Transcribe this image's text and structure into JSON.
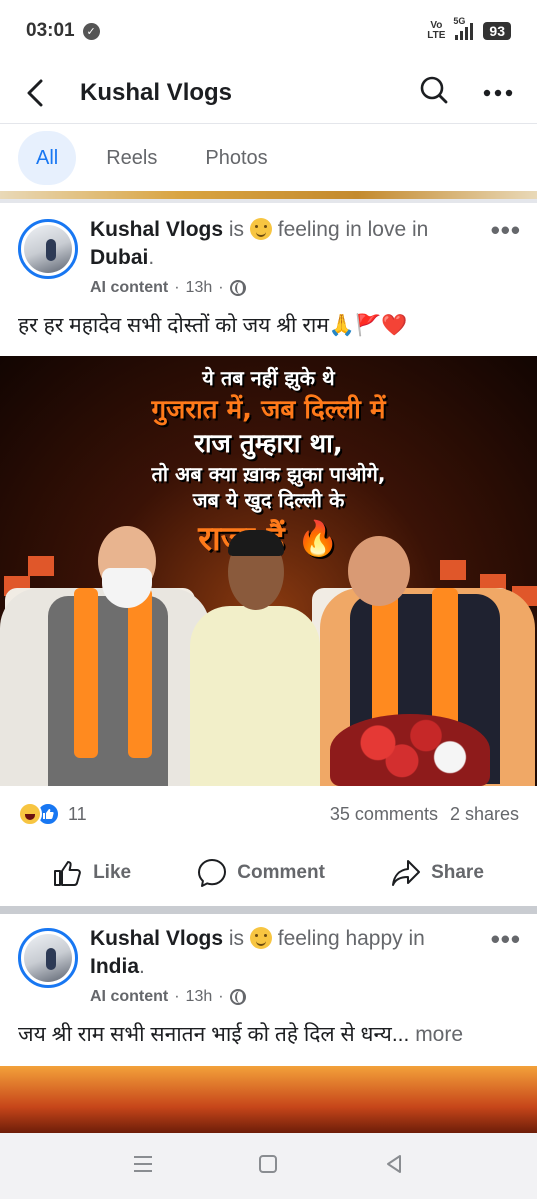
{
  "status_bar": {
    "time": "03:01",
    "network": "Vo LTE",
    "network_gen": "5G",
    "battery": "93"
  },
  "header": {
    "title": "Kushal Vlogs"
  },
  "tabs": [
    {
      "label": "All",
      "active": true
    },
    {
      "label": "Reels",
      "active": false
    },
    {
      "label": "Photos",
      "active": false
    }
  ],
  "posts": [
    {
      "author": "Kushal Vlogs",
      "is": "is",
      "feeling": "feeling in love in",
      "location": "Dubai",
      "ai_label": "AI content",
      "time": "13h",
      "caption": "हर हर महादेव सभी दोस्तों को जय श्री राम🙏🚩❤️",
      "image_text": {
        "line1": "ये तब नहीं झुके थे",
        "line2": "गुजरात में, जब दिल्ली में",
        "line3": "राज तुम्हारा था,",
        "line4": "तो अब क्या ख़ाक झुका पाओगे,",
        "line5": "जब ये खुद दिल्ली के",
        "line6": "राजा हैं 🔥"
      },
      "reaction_count": "11",
      "comments": "35 comments",
      "shares": "2 shares"
    },
    {
      "author": "Kushal Vlogs",
      "is": "is",
      "feeling": "feeling happy in",
      "location": "India",
      "ai_label": "AI content",
      "time": "13h",
      "caption": "जय श्री राम सभी सनातन भाई को तहे दिल से धन्य...",
      "more": "more"
    }
  ],
  "actions": {
    "like": "Like",
    "comment": "Comment",
    "share": "Share"
  },
  "colors": {
    "accent": "#1877f2",
    "tab_active_bg": "#e7f0fd",
    "secondary_text": "#65676b"
  }
}
